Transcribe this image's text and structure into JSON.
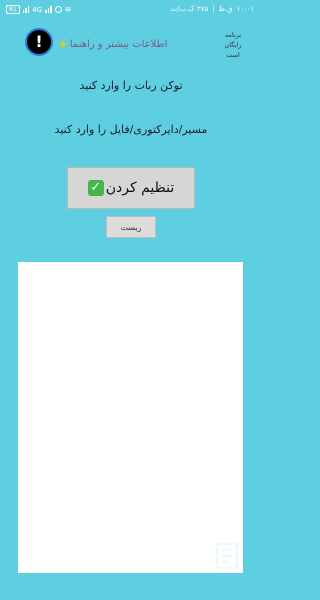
{
  "status_bar": {
    "time": "۱۰:۰۱",
    "am_pm": "ق.ظ",
    "speed": "۳۷۵ ک.ب/ث",
    "battery": "81",
    "network": "4G"
  },
  "header": {
    "more_info_label": "اطلاعات بیشتر و راهنما",
    "free_app_lines": [
      "برنامه",
      "رایگان",
      "است"
    ]
  },
  "prompts": {
    "token": "توکن ربات را وارد کنید",
    "path": "مسیر/دایرکتوری/فایل را وارد کنید"
  },
  "buttons": {
    "set_label": "تنظیم کردن",
    "reset_label": "ریست"
  },
  "colors": {
    "background": "#5ecfe0",
    "check": "#47b54c",
    "star": "#f2c21b"
  },
  "icons": {
    "warning": "exclamation-icon",
    "star": "star-icon",
    "check": "check-mark-icon"
  }
}
